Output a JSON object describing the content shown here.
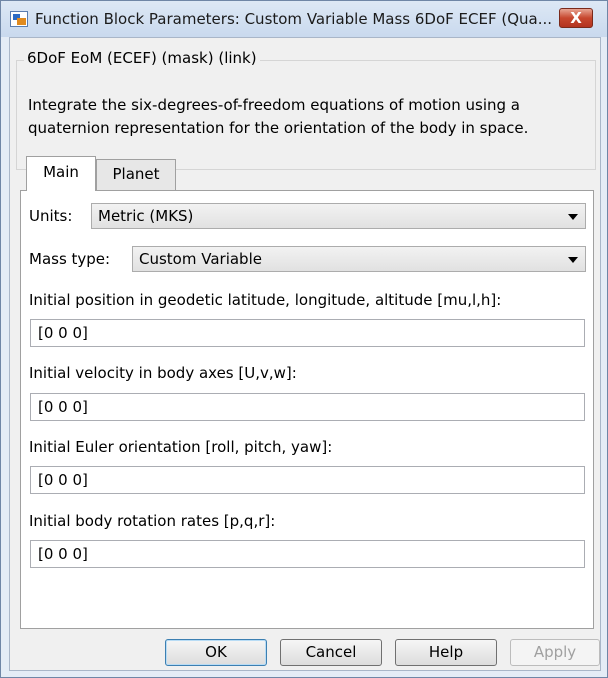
{
  "window": {
    "title": "Function Block Parameters: Custom Variable Mass 6DoF ECEF (Qua...",
    "close_label": "X"
  },
  "group": {
    "legend": "6DoF EoM (ECEF) (mask) (link)",
    "description_line1": "Integrate the six-degrees-of-freedom equations of motion using a",
    "description_line2": "quaternion representation for the orientation of the body in space."
  },
  "tabs": [
    {
      "label": "Main",
      "active": true
    },
    {
      "label": "Planet",
      "active": false
    }
  ],
  "main": {
    "units_label": "Units:",
    "units_value": "Metric (MKS)",
    "mass_type_label": "Mass type:",
    "mass_type_value": "Custom Variable",
    "initial_position_label": "Initial position in geodetic latitude, longitude, altitude [mu,l,h]:",
    "initial_position_value": "[0 0 0]",
    "initial_velocity_label": "Initial velocity in body axes [U,v,w]:",
    "initial_velocity_value": "[0 0 0]",
    "initial_euler_label": "Initial Euler orientation [roll, pitch, yaw]:",
    "initial_euler_value": "[0 0 0]",
    "initial_rates_label": "Initial body rotation rates [p,q,r]:",
    "initial_rates_value": "[0 0 0]"
  },
  "buttons": {
    "ok": "OK",
    "cancel": "Cancel",
    "help": "Help",
    "apply": "Apply"
  }
}
